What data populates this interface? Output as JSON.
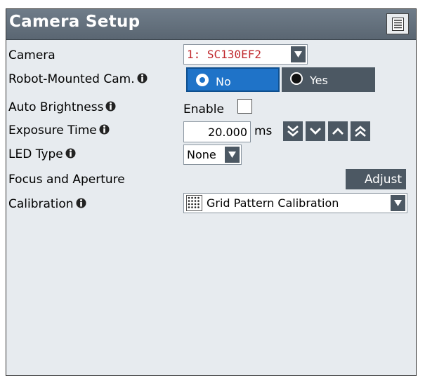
{
  "panel": {
    "title": "Camera Setup",
    "menu_icon": "list-icon"
  },
  "camera": {
    "label": "Camera",
    "value": "1: SC130EF2",
    "value_color": "#c0282d"
  },
  "robot_mounted": {
    "label": "Robot-Mounted Cam.",
    "options": [
      "No",
      "Yes"
    ],
    "selected": "No",
    "selected_color": "#1f73c8"
  },
  "auto_brightness": {
    "label": "Auto Brightness",
    "checkbox_label": "Enable",
    "checked": false
  },
  "exposure": {
    "label": "Exposure Time",
    "value": "20.000",
    "unit": "ms"
  },
  "led_type": {
    "label": "LED Type",
    "value": "None"
  },
  "focus": {
    "label": "Focus and Aperture",
    "button_label": "Adjust"
  },
  "calibration": {
    "label": "Calibration",
    "value": "Grid Pattern Calibration",
    "icon": "grid-pattern-icon"
  },
  "icons": {
    "info": "info-icon",
    "dropdown": "dropdown-arrow-icon"
  },
  "colors": {
    "titlebar": "#5f6b77",
    "panel_bg": "#e7ebef",
    "button": "#4c5863",
    "selected": "#1f73c8"
  }
}
